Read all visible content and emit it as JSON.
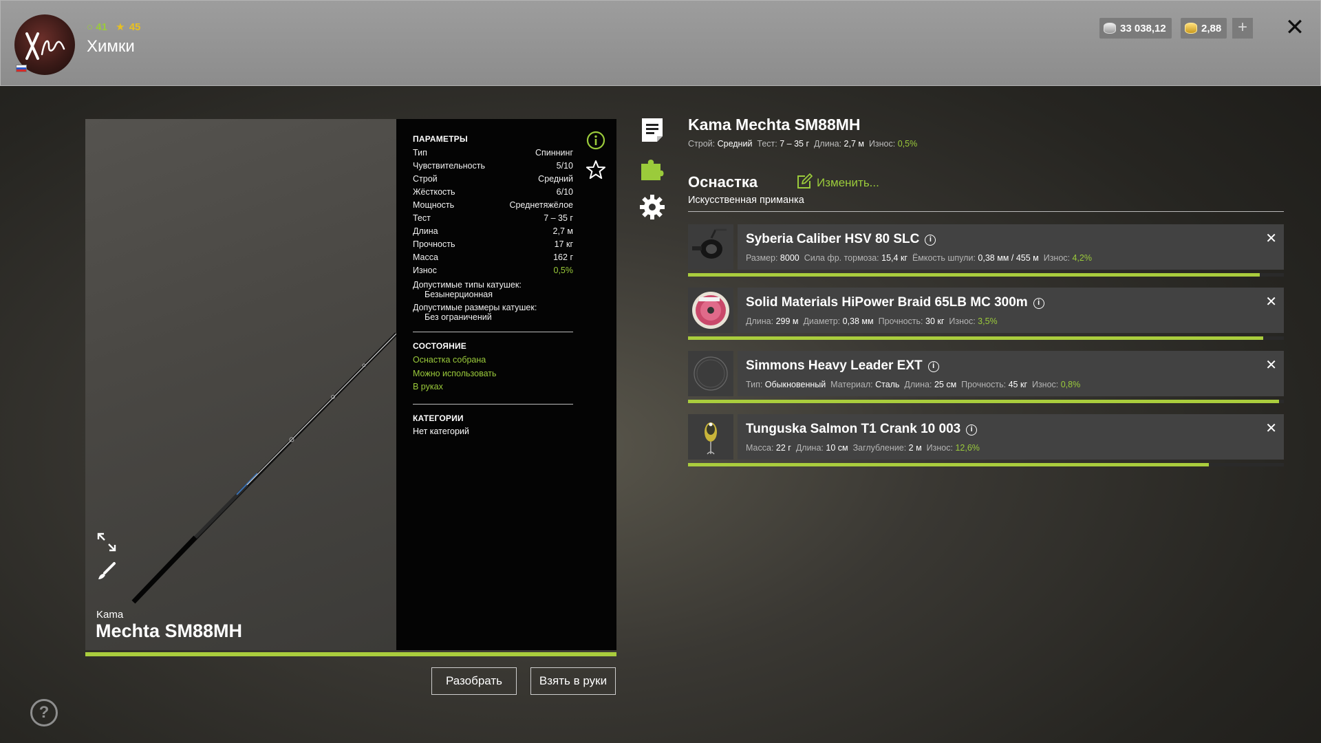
{
  "player": {
    "level1": "41",
    "level2": "45",
    "name": "Химки"
  },
  "currency": {
    "silver": "33 038,12",
    "gold": "2,88",
    "plus": "+"
  },
  "close_label": "✕",
  "rod": {
    "brand": "Kama",
    "model": "Mechta SM88MH"
  },
  "params": {
    "title": "ПАРАМЕТРЫ",
    "rows": [
      {
        "label": "Тип",
        "value": "Спиннинг"
      },
      {
        "label": "Чувствительность",
        "value": "5/10"
      },
      {
        "label": "Строй",
        "value": "Средний"
      },
      {
        "label": "Жёсткость",
        "value": "6/10"
      },
      {
        "label": "Мощность",
        "value": "Среднетяжёлое"
      },
      {
        "label": "Тест",
        "value": "7 – 35 г"
      },
      {
        "label": "Длина",
        "value": "2,7 м"
      },
      {
        "label": "Прочность",
        "value": "17 кг"
      },
      {
        "label": "Масса",
        "value": "162 г"
      },
      {
        "label": "Износ",
        "value": "0,5%"
      }
    ],
    "reel_types_label": "Допустимые типы катушек:",
    "reel_types_value": "Безынерционная",
    "reel_sizes_label": "Допустимые размеры катушек:",
    "reel_sizes_value": "Без ограничений"
  },
  "state": {
    "title": "СОСТОЯНИЕ",
    "items": [
      "Оснастка собрана",
      "Можно использовать",
      "В руках"
    ]
  },
  "categories": {
    "title": "КАТЕГОРИИ",
    "value": "Нет категорий"
  },
  "buttons": {
    "disassemble": "Разобрать",
    "take": "Взять в руки"
  },
  "help_label": "?",
  "detail": {
    "title": "Kama Mechta SM88MH",
    "sub": {
      "stroy_label": "Строй:",
      "stroy": "Средний",
      "test_label": "Тест:",
      "test": "7 – 35 г",
      "length_label": "Длина:",
      "length": "2,7 м",
      "wear_label": "Износ:",
      "wear": "0,5%"
    },
    "rig_title": "Оснастка",
    "edit_label": "Изменить...",
    "lure_type": "Искусственная приманка"
  },
  "items": [
    {
      "name": "Syberia Caliber HSV 80 SLC",
      "specs": [
        {
          "label": "Размер:",
          "value": "8000"
        },
        {
          "label": "Сила фр. тормоза:",
          "value": "15,4 кг"
        },
        {
          "label": "Ёмкость шпули:",
          "value": "0,38 мм / 455 м"
        },
        {
          "label": "Износ:",
          "value": "4,2%",
          "green": true
        }
      ],
      "condition": 0.96
    },
    {
      "name": "Solid Materials HiPower Braid 65LB MC 300m",
      "specs": [
        {
          "label": "Длина:",
          "value": "299 м"
        },
        {
          "label": "Диаметр:",
          "value": "0,38 мм"
        },
        {
          "label": "Прочность:",
          "value": "30 кг"
        },
        {
          "label": "Износ:",
          "value": "3,5%",
          "green": true
        }
      ],
      "condition": 0.965
    },
    {
      "name": "Simmons Heavy Leader EXT",
      "specs": [
        {
          "label": "Тип:",
          "value": "Обыкновенный"
        },
        {
          "label": "Материал:",
          "value": "Сталь"
        },
        {
          "label": "Длина:",
          "value": "25 см"
        },
        {
          "label": "Прочность:",
          "value": "45 кг"
        },
        {
          "label": "Износ:",
          "value": "0,8%",
          "green": true
        }
      ],
      "condition": 0.992
    },
    {
      "name": "Tunguska Salmon T1 Crank 10 003",
      "specs": [
        {
          "label": "Масса:",
          "value": "22 г"
        },
        {
          "label": "Длина:",
          "value": "10 см"
        },
        {
          "label": "Заглубление:",
          "value": "2 м"
        },
        {
          "label": "Износ:",
          "value": "12,6%",
          "green": true
        }
      ],
      "condition": 0.874
    }
  ],
  "icons": {
    "side": [
      "document-icon",
      "puzzle-icon",
      "gear-icon"
    ],
    "rod_tools": [
      "expand-icon",
      "brush-icon"
    ]
  },
  "colors": {
    "accent": "#9bcb3b",
    "bar": "#aacd3d",
    "gold": "#e8c020"
  }
}
